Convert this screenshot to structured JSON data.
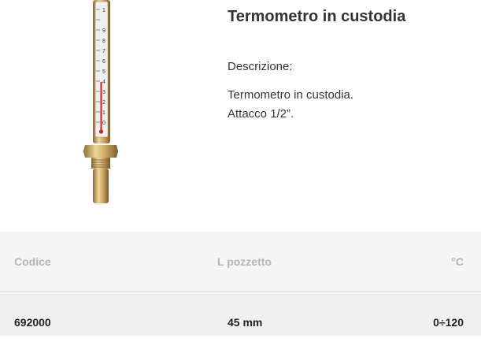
{
  "product": {
    "title": "Termometro in custodia",
    "description_label": "Descrizione:",
    "description_lines": [
      "Termometro in custodia.",
      "Attacco 1/2”."
    ]
  },
  "table": {
    "headers": [
      "Codice",
      "L pozzetto",
      "°C"
    ],
    "rows": [
      [
        "692000",
        "45 mm",
        "0÷120"
      ]
    ]
  },
  "image": {
    "icon": "thermometer-product-image",
    "scale_labels": [
      "1",
      "9",
      "8",
      "7",
      "6",
      "5",
      "4",
      "3",
      "2",
      "1",
      "0"
    ]
  },
  "colors": {
    "brass": "#c9a86a",
    "mercury": "#cc2222",
    "header_bg": "#f5f5f5",
    "row_bg": "#f0f0f0",
    "header_text": "#b5b5b5"
  }
}
